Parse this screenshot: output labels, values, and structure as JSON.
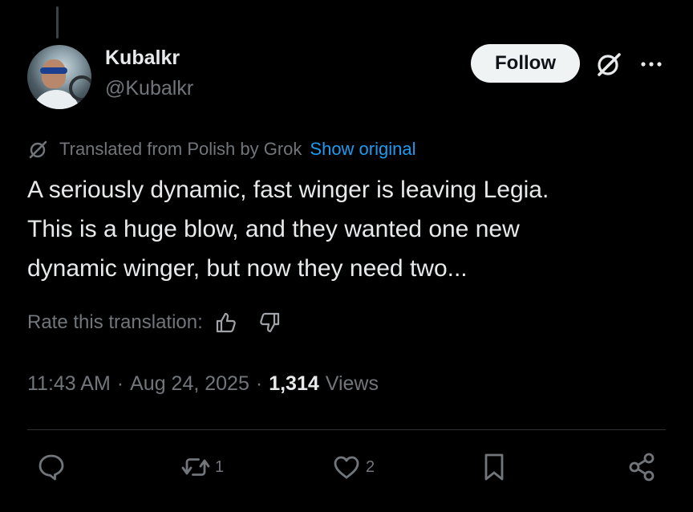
{
  "author": {
    "name": "Kubalkr",
    "handle": "@Kubalkr"
  },
  "header": {
    "follow_label": "Follow",
    "grok_icon": "grok-icon",
    "more_icon": "more-icon"
  },
  "translation": {
    "notice": "Translated from Polish by Grok",
    "show_original": "Show original",
    "rate_label": "Rate this translation:"
  },
  "tweet": {
    "lines": [
      "A seriously dynamic, fast winger is leaving Legia.",
      "This is a huge blow, and they wanted one new",
      "dynamic winger, but now they need two..."
    ]
  },
  "meta": {
    "time": "11:43 AM",
    "sep1": "·",
    "date": "Aug 24, 2025",
    "sep2": "·",
    "views_count": "1,314",
    "views_label": "Views"
  },
  "actions": {
    "reply_count": "",
    "retweet_count": "1",
    "like_count": "2"
  },
  "colors": {
    "background": "#000000",
    "text": "#e7e9ea",
    "muted": "#71767b",
    "link": "#1d9bf0",
    "follow_bg": "#eff3f4"
  }
}
